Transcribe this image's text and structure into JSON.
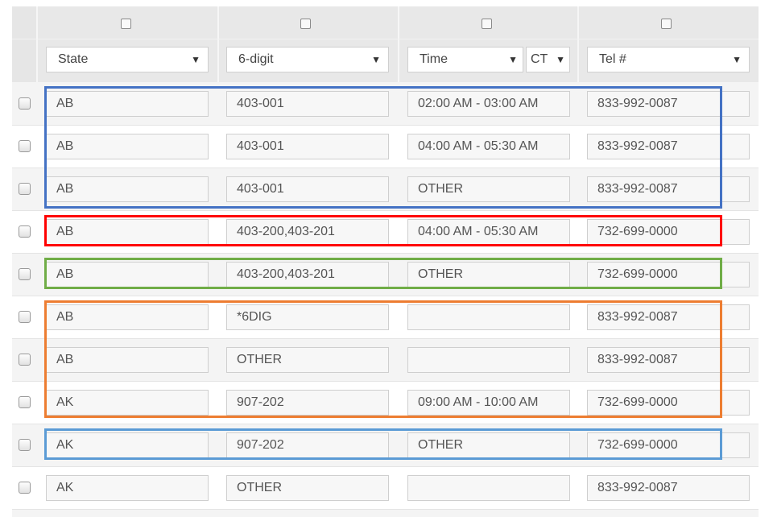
{
  "header": {
    "columns": [
      {
        "label": "State"
      },
      {
        "label": "6-digit"
      },
      {
        "label": "Time",
        "zone": "CT"
      },
      {
        "label": "Tel #"
      }
    ]
  },
  "icons": {
    "dropdown": "chevron-down-icon"
  },
  "rows": [
    {
      "state": "AB",
      "code": "403-001",
      "time": "02:00 AM - 03:00 AM",
      "tel": "833-992-0087"
    },
    {
      "state": "AB",
      "code": "403-001",
      "time": "04:00 AM - 05:30 AM",
      "tel": "833-992-0087"
    },
    {
      "state": "AB",
      "code": "403-001",
      "time": "OTHER",
      "tel": "833-992-0087"
    },
    {
      "state": "AB",
      "code": "403-200,403-201",
      "time": "04:00 AM - 05:30 AM",
      "tel": "732-699-0000"
    },
    {
      "state": "AB",
      "code": "403-200,403-201",
      "time": "OTHER",
      "tel": "732-699-0000"
    },
    {
      "state": "AB",
      "code": "*6DIG",
      "time": "",
      "tel": "833-992-0087"
    },
    {
      "state": "AB",
      "code": "OTHER",
      "time": "",
      "tel": "833-992-0087"
    },
    {
      "state": "AK",
      "code": "907-202",
      "time": "09:00 AM - 10:00 AM",
      "tel": "732-699-0000"
    },
    {
      "state": "AK",
      "code": "907-202",
      "time": "OTHER",
      "tel": "732-699-0000"
    },
    {
      "state": "AK",
      "code": "OTHER",
      "time": "",
      "tel": "833-992-0087"
    }
  ],
  "highlight_colors": [
    "#4472c4",
    "#ff0000",
    "#70ad47",
    "#ed7d31",
    "#5b9bd5"
  ]
}
